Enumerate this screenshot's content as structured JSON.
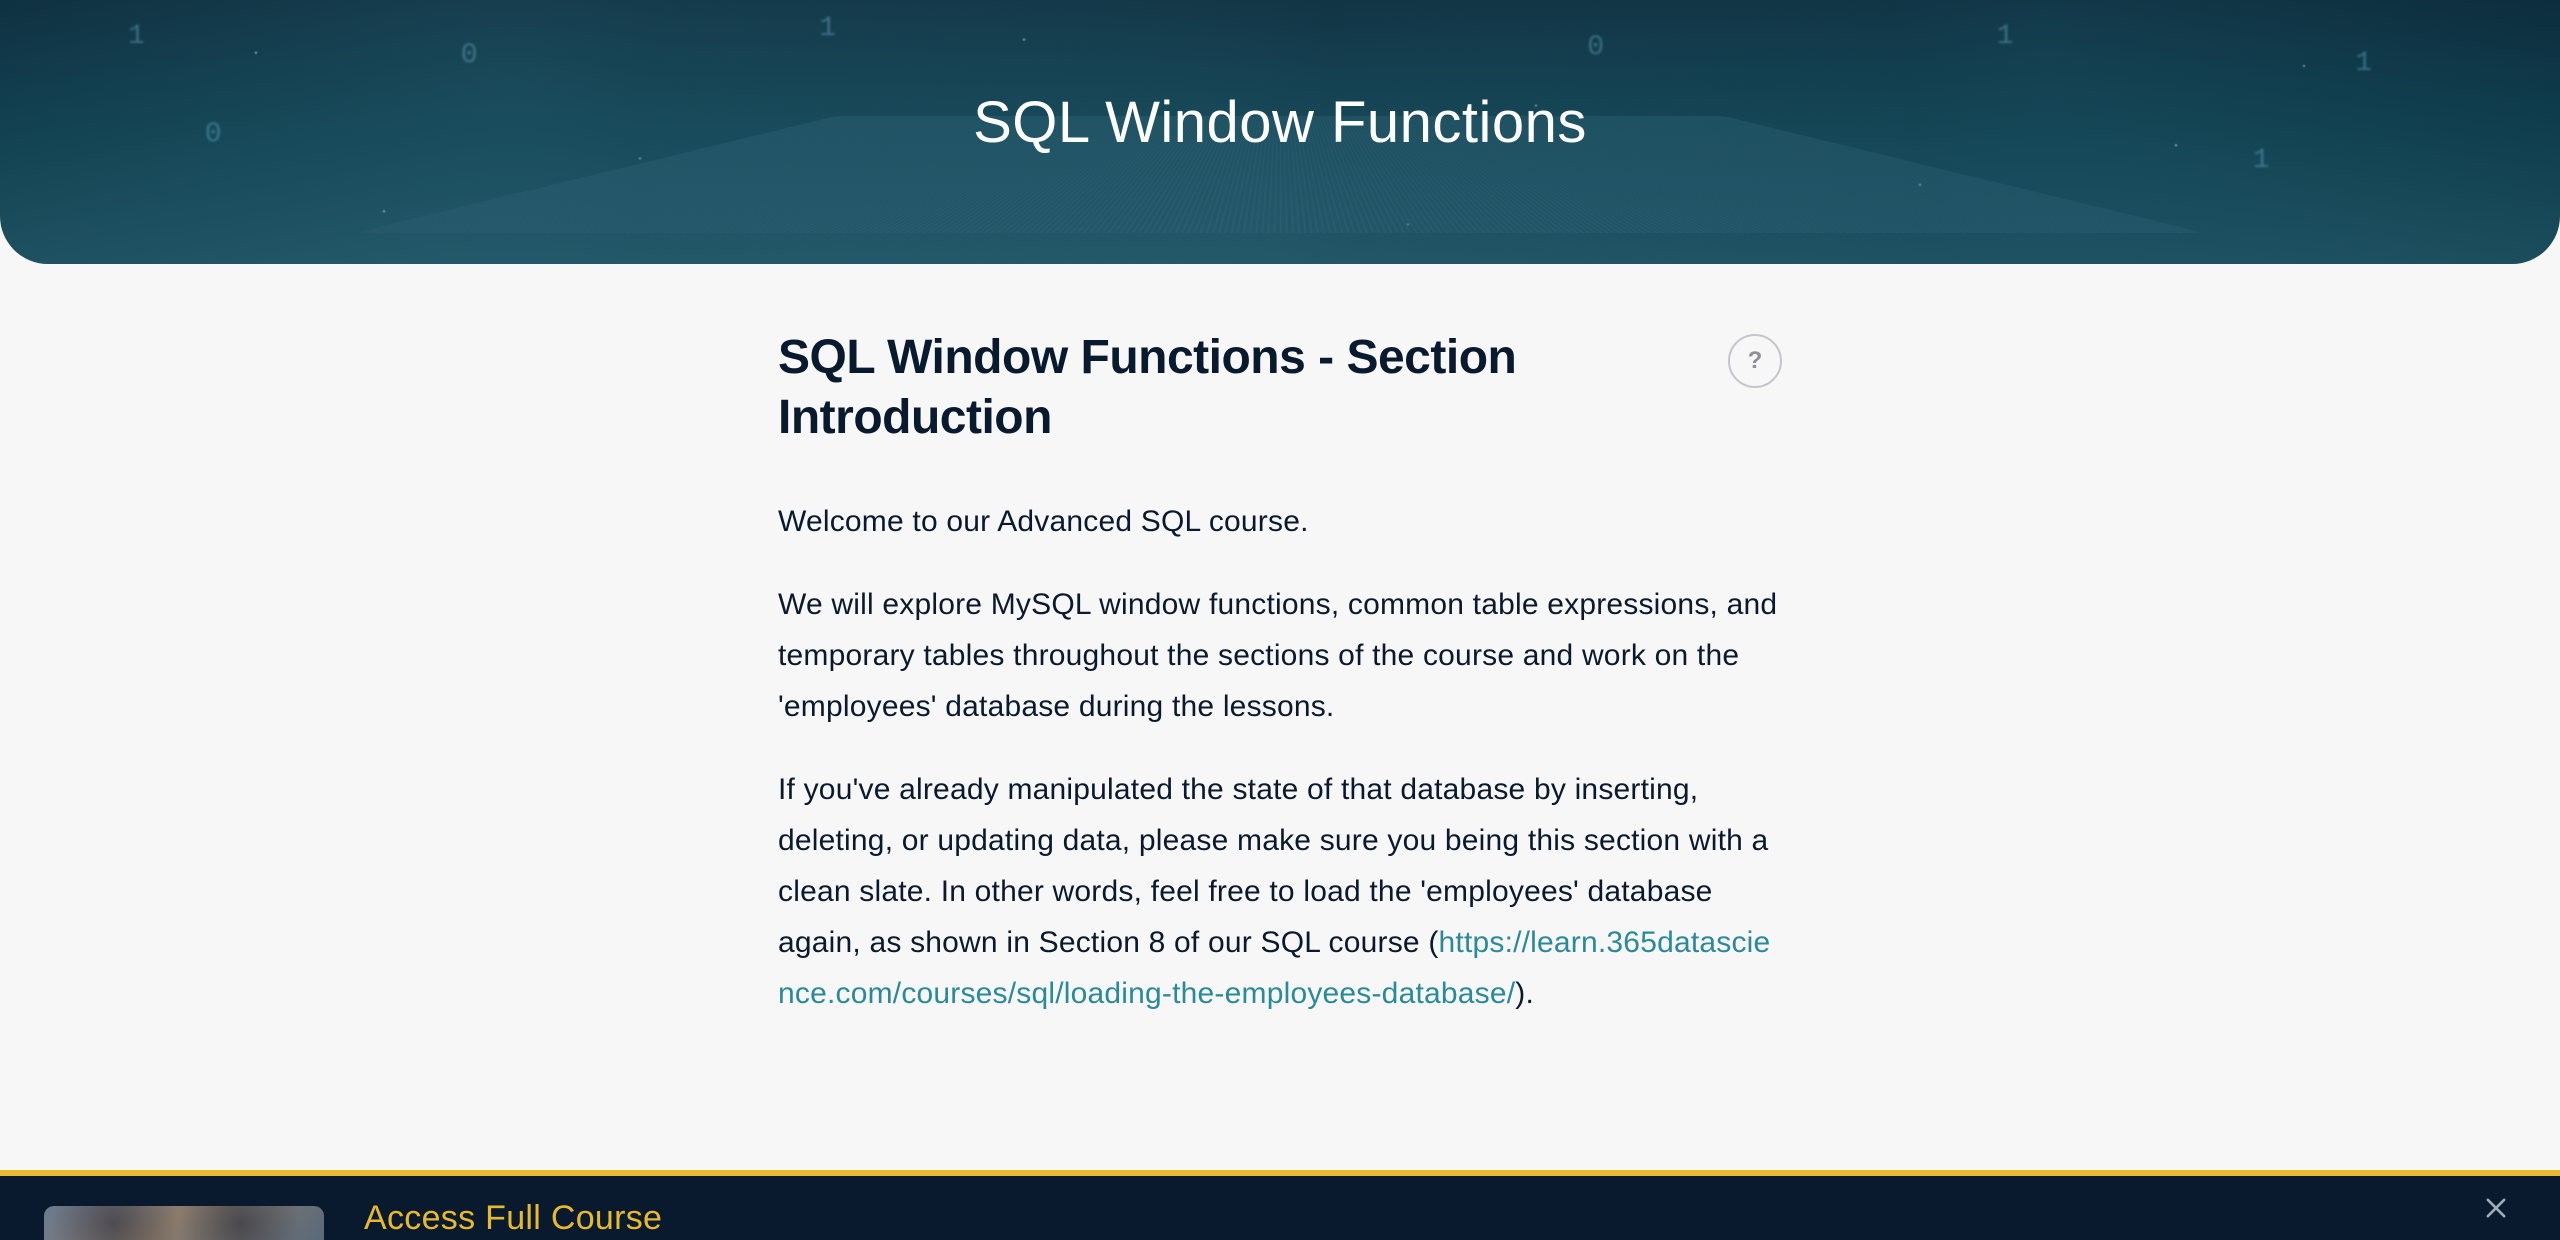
{
  "hero": {
    "title": "SQL Window Functions"
  },
  "section": {
    "title": "SQL Window Functions - Section Introduction"
  },
  "paragraphs": {
    "p1": "Welcome to our Advanced SQL course.",
    "p2": "We will explore MySQL window functions, common table expressions, and temporary tables throughout the sections of the course and work on the 'employees' database during the lessons.",
    "p3_a": "If you've already manipulated the state of that database by inserting, deleting, or updating data, please make sure you being this section with a clean slate. In other words, feel free to load the 'employees' database again, as shown in Section 8 of our SQL course (",
    "p3_link": "https://learn.365datascience.com/courses/sql/loading-the-employees-database/",
    "p3_b": ")."
  },
  "help": {
    "label": "?"
  },
  "banner": {
    "title": "Access Full Course"
  }
}
